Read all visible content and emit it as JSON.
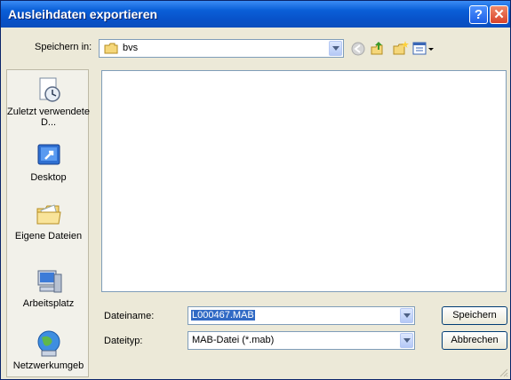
{
  "window": {
    "title": "Ausleihdaten exportieren",
    "help_label": "?",
    "close_label": "✕"
  },
  "savein": {
    "label": "Speichern in:",
    "folder": "bvs"
  },
  "places": [
    {
      "label": "Zuletzt verwendete D...",
      "icon": "recent-documents-icon"
    },
    {
      "label": "Desktop",
      "icon": "desktop-icon"
    },
    {
      "label": "Eigene Dateien",
      "icon": "my-documents-icon"
    },
    {
      "label": "Arbeitsplatz",
      "icon": "my-computer-icon"
    },
    {
      "label": "Netzwerkumgeb",
      "icon": "network-icon"
    }
  ],
  "filename": {
    "label": "Dateiname:",
    "value": "L000467.MAB"
  },
  "filetype": {
    "label": "Dateityp:",
    "value": "MAB-Datei (*.mab)"
  },
  "buttons": {
    "save": "Speichern",
    "cancel": "Abbrechen"
  }
}
